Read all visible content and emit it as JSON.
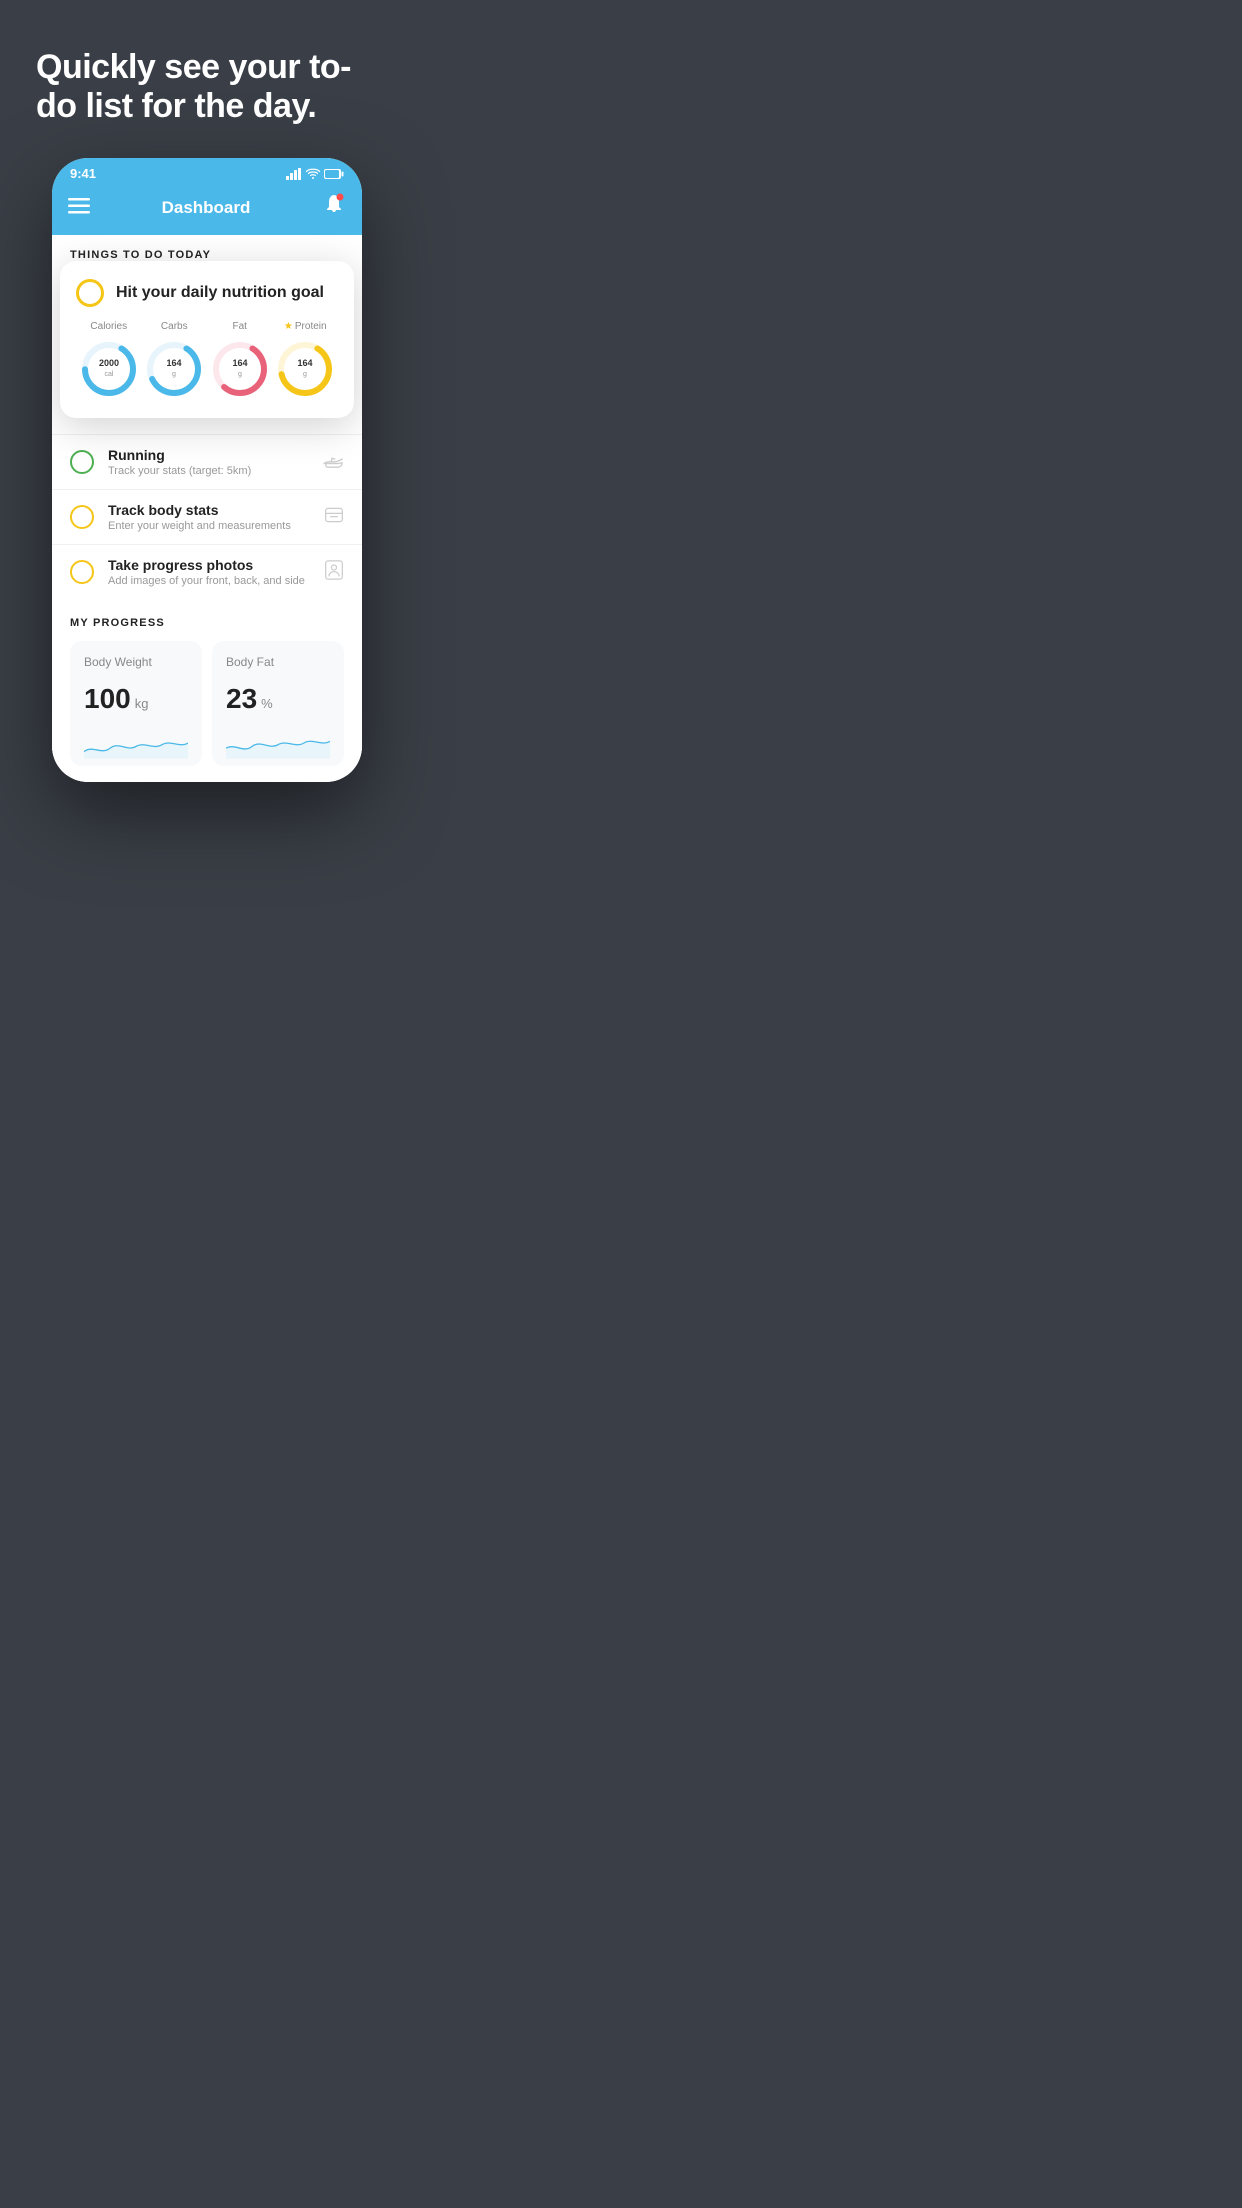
{
  "hero": {
    "title": "Quickly see your to-do list for the day."
  },
  "status_bar": {
    "time": "9:41",
    "icons": "signal wifi battery"
  },
  "navbar": {
    "title": "Dashboard"
  },
  "things_to_do": {
    "section_label": "THINGS TO DO TODAY"
  },
  "nutrition_card": {
    "title": "Hit your daily nutrition goal",
    "items": [
      {
        "label": "Calories",
        "value": "2000",
        "unit": "cal",
        "color": "#4ab8e8",
        "star": false
      },
      {
        "label": "Carbs",
        "value": "164",
        "unit": "g",
        "color": "#4ab8e8",
        "star": false
      },
      {
        "label": "Fat",
        "value": "164",
        "unit": "g",
        "color": "#e8627a",
        "star": false
      },
      {
        "label": "Protein",
        "value": "164",
        "unit": "g",
        "color": "#f5c518",
        "star": true
      }
    ]
  },
  "todo_items": [
    {
      "title": "Running",
      "subtitle": "Track your stats (target: 5km)",
      "circle": "green",
      "icon": "👟"
    },
    {
      "title": "Track body stats",
      "subtitle": "Enter your weight and measurements",
      "circle": "yellow",
      "icon": "⚖"
    },
    {
      "title": "Take progress photos",
      "subtitle": "Add images of your front, back, and side",
      "circle": "yellow",
      "icon": "👤"
    }
  ],
  "progress": {
    "section_label": "MY PROGRESS",
    "cards": [
      {
        "title": "Body Weight",
        "value": "100",
        "unit": "kg"
      },
      {
        "title": "Body Fat",
        "value": "23",
        "unit": "%"
      }
    ]
  }
}
